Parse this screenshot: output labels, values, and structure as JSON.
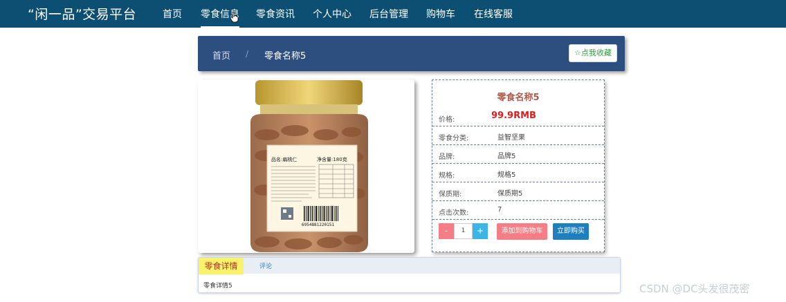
{
  "nav": {
    "brand": "“闲一品”交易平台",
    "items": [
      "首页",
      "零食信息",
      "零食资讯",
      "个人中心",
      "后台管理",
      "购物车",
      "在线客服"
    ],
    "active_index": 1
  },
  "breadcrumb": {
    "home": "首页",
    "separator": "/",
    "current": "零食名称5",
    "favorite_label": "☆点我收藏"
  },
  "product": {
    "image_alt": "Almond jar",
    "jar_label_name": "品名:扁桃仁",
    "jar_label_weight": "净含量:180克",
    "barcode_number": "6954881220151",
    "name": "零食名称5",
    "price_label": "价格:",
    "price": "99.9RMB",
    "attributes": [
      {
        "label": "零食分类:",
        "value": "益智坚果"
      },
      {
        "label": "品牌:",
        "value": "品牌5"
      },
      {
        "label": "规格:",
        "value": "规格5"
      },
      {
        "label": "保质期:",
        "value": "保质期5"
      },
      {
        "label": "点击次数:",
        "value": "7"
      }
    ],
    "quantity": {
      "minus": "-",
      "value": "1",
      "plus": "+"
    },
    "add_to_cart_label": "添加到购物车",
    "buy_now_label": "立即购买"
  },
  "tabs": {
    "items": [
      "零食详情",
      "评论"
    ],
    "active_index": 0,
    "content": "零食详情5"
  },
  "watermark": "CSDN @DC头发很茂密",
  "colors": {
    "nav_bg": "#0d4f73",
    "crumb_bg": "#2c4f80",
    "price": "#e21b1b",
    "cart_btn": "#f47d86",
    "buy_btn": "#1e7fbf",
    "tab_active_bg": "#f8f36a"
  }
}
